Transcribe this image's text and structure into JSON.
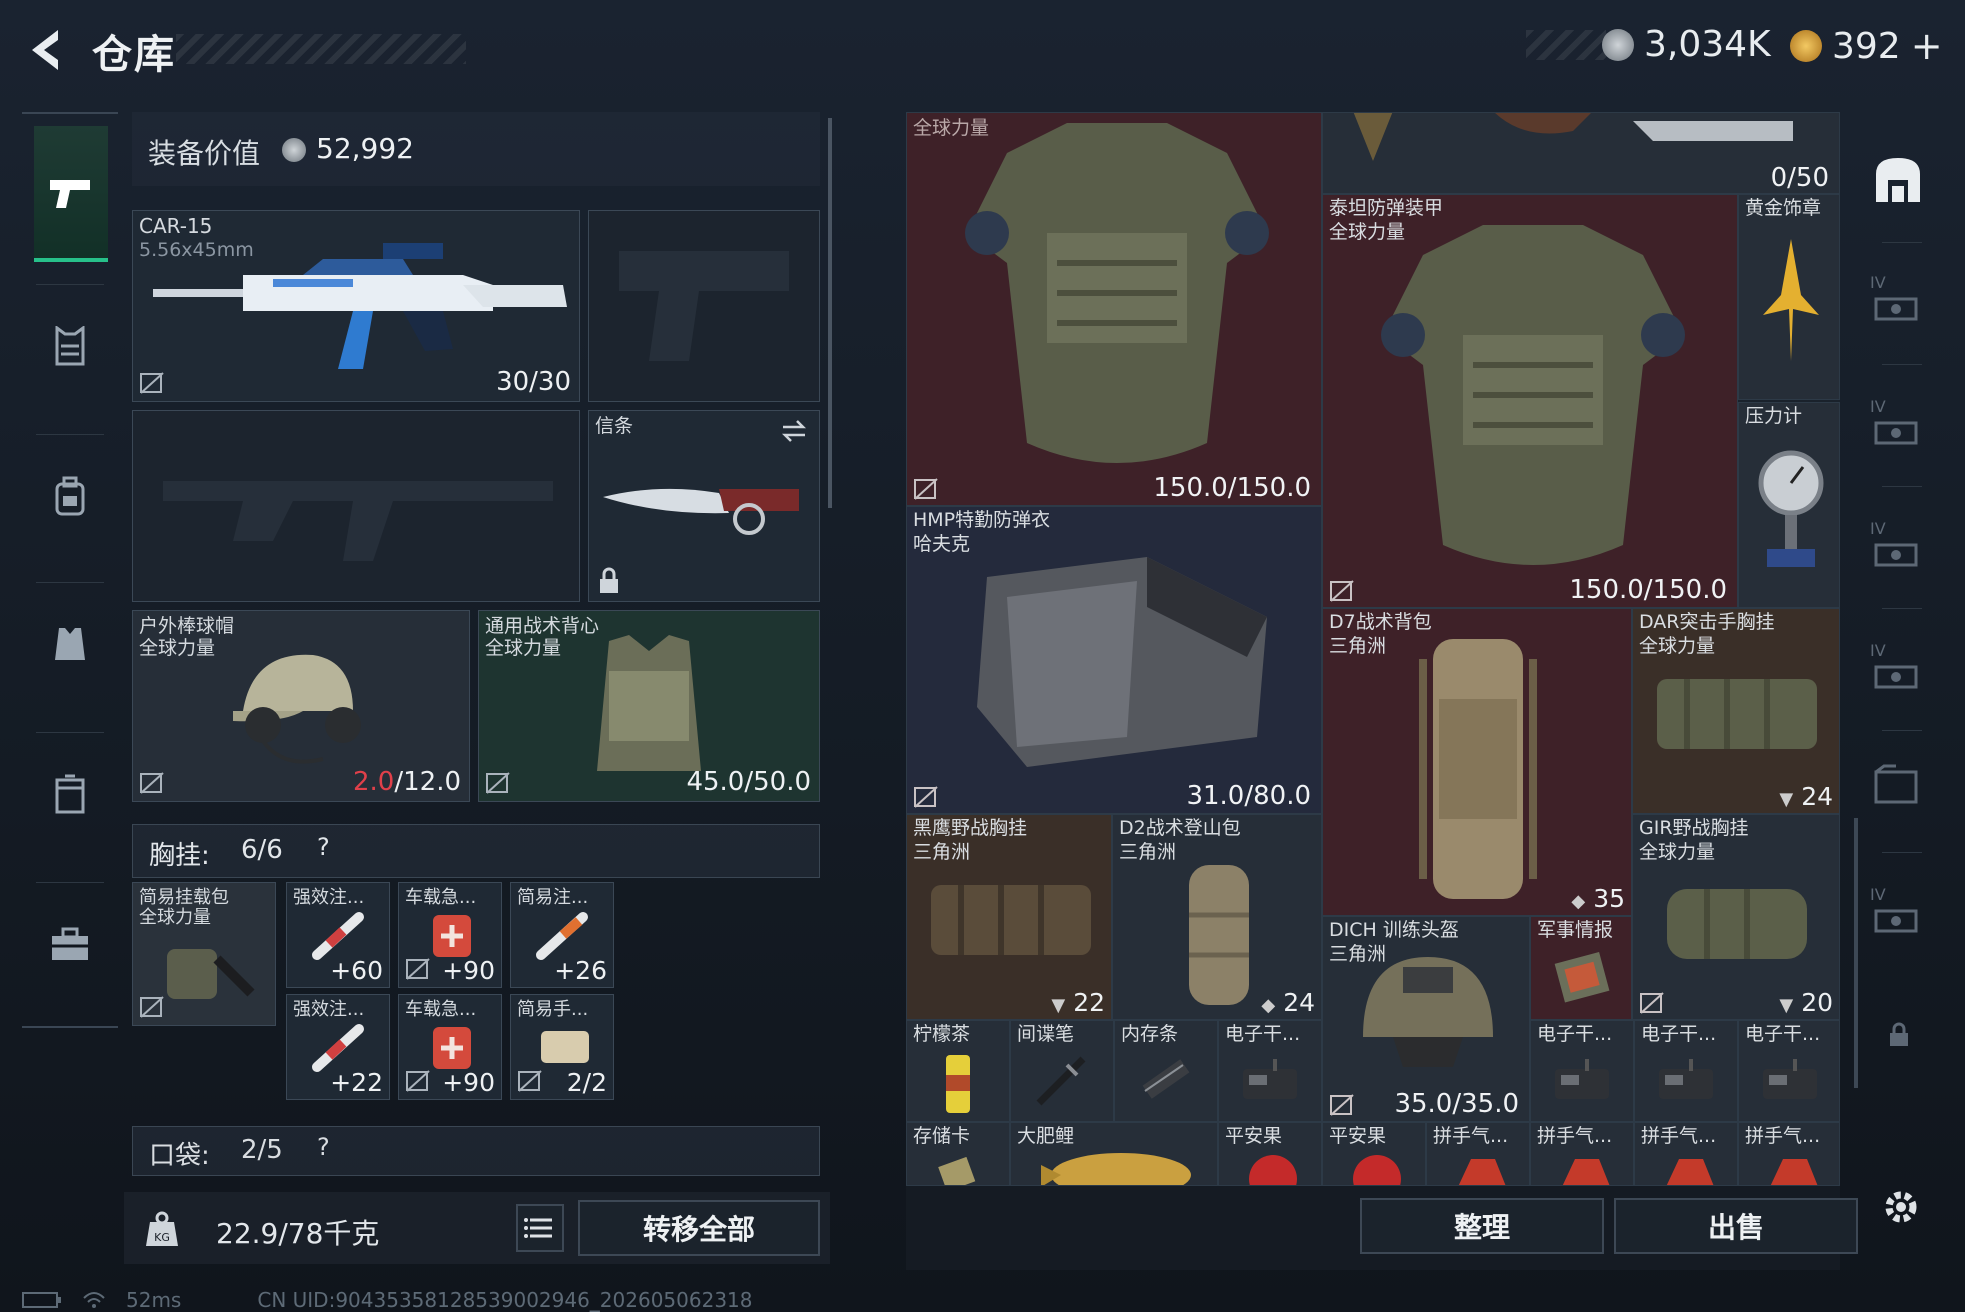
{
  "header": {
    "title": "仓库",
    "currency_silver": "3,034K",
    "currency_gold": "392",
    "gold_plus": "+"
  },
  "loadout": {
    "equip_value_label": "装备价值",
    "equip_value": "52,992",
    "primary": {
      "name": "CAR-15",
      "caliber": "5.56x45mm",
      "ammo": "30/30"
    },
    "melee": {
      "name": "信条"
    },
    "helmet": {
      "name": "户外棒球帽",
      "tag": "全球力量",
      "dur_cur": "2.0",
      "dur_max": "/12.0"
    },
    "armor": {
      "name": "通用战术背心",
      "tag": "全球力量",
      "durability": "45.0/50.0"
    },
    "chest_rig_label": "胸挂:",
    "chest_rig_count": "6/6",
    "pocket_label": "口袋:",
    "pocket_count": "2/5",
    "help": "?",
    "rig_items": [
      {
        "name": "简易挂载包",
        "tag": "全球力量",
        "qty": ""
      },
      {
        "name": "强效注...",
        "qty": "+60"
      },
      {
        "name": "车载急...",
        "qty": "+90"
      },
      {
        "name": "简易注...",
        "qty": "+26"
      },
      {
        "name": "强效注...",
        "qty": "+22"
      },
      {
        "name": "车载急...",
        "qty": "+90"
      },
      {
        "name": "简易手...",
        "qty": "2/2"
      }
    ],
    "weight": "22.9/78千克",
    "transfer_all": "转移全部"
  },
  "stash": {
    "capacity": "0/50",
    "items": [
      {
        "name": "",
        "tag": "全球力量",
        "val": "150.0/150.0"
      },
      {
        "name": "泰坦防弹装甲",
        "tag": "全球力量",
        "val": "150.0/150.0"
      },
      {
        "name": "黄金饰章",
        "val": ""
      },
      {
        "name": "压力计",
        "val": ""
      },
      {
        "name": "HMP特勤防弹衣",
        "tag": "哈夫克",
        "val": "31.0/80.0"
      },
      {
        "name": "D7战术背包",
        "tag": "三角洲",
        "val": "35"
      },
      {
        "name": "DAR突击手胸挂",
        "tag": "全球力量",
        "val": "24"
      },
      {
        "name": "黑鹰野战胸挂",
        "tag": "三角洲",
        "val": "22"
      },
      {
        "name": "D2战术登山包",
        "tag": "三角洲",
        "val": "24"
      },
      {
        "name": "DICH 训练头盔",
        "tag": "三角洲",
        "val": "35.0/35.0"
      },
      {
        "name": "军事情报",
        "val": ""
      },
      {
        "name": "GIR野战胸挂",
        "tag": "全球力量",
        "val": "20"
      },
      {
        "name": "柠檬茶",
        "val": ""
      },
      {
        "name": "间谍笔",
        "val": ""
      },
      {
        "name": "内存条",
        "val": ""
      },
      {
        "name": "电子干...",
        "val": ""
      },
      {
        "name": "电子干...",
        "val": ""
      },
      {
        "name": "电子干...",
        "val": ""
      },
      {
        "name": "电子干...",
        "val": ""
      },
      {
        "name": "存储卡",
        "val": ""
      },
      {
        "name": "大肥鲤",
        "val": ""
      },
      {
        "name": "平安果",
        "val": ""
      },
      {
        "name": "平安果",
        "val": ""
      },
      {
        "name": "拼手气...",
        "val": ""
      },
      {
        "name": "拼手气...",
        "val": ""
      },
      {
        "name": "拼手气...",
        "val": ""
      },
      {
        "name": "拼手气...",
        "val": ""
      }
    ],
    "sort": "整理",
    "sell": "出售"
  },
  "rail": {
    "tier": "IV"
  },
  "status": {
    "ping": "52ms",
    "uid": "CN UID:9043535812853900​2946_202605062318"
  },
  "colors": {
    "accent_green": "#27c08a",
    "red_durability": "#e0404a",
    "cell_red": "#3e2128",
    "cell_navy": "#242a3c"
  }
}
